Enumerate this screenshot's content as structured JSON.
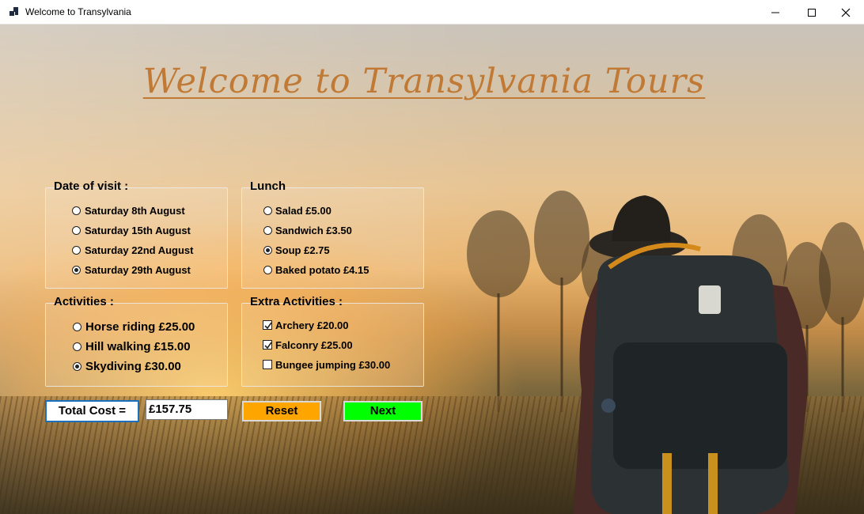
{
  "window": {
    "title": "Welcome to Transylvania"
  },
  "heading": "Welcome to Transylvania Tours",
  "date_group": {
    "legend": "Date of visit :",
    "options": [
      {
        "label": "Saturday 8th August",
        "selected": false
      },
      {
        "label": "Saturday 15th August",
        "selected": false
      },
      {
        "label": "Saturday 22nd August",
        "selected": false
      },
      {
        "label": "Saturday 29th August",
        "selected": true
      }
    ]
  },
  "lunch_group": {
    "legend": "Lunch",
    "options": [
      {
        "label": "Salad £5.00",
        "selected": false
      },
      {
        "label": "Sandwich £3.50",
        "selected": false
      },
      {
        "label": "Soup £2.75",
        "selected": true
      },
      {
        "label": "Baked potato £4.15",
        "selected": false
      }
    ]
  },
  "activities_group": {
    "legend": "Activities :",
    "options": [
      {
        "label": "Horse riding £25.00",
        "selected": false
      },
      {
        "label": "Hill walking £15.00",
        "selected": false
      },
      {
        "label": "Skydiving £30.00",
        "selected": true
      }
    ]
  },
  "extra_group": {
    "legend": "Extra Activities :",
    "options": [
      {
        "label": "Archery £20.00",
        "checked": true
      },
      {
        "label": "Falconry £25.00",
        "checked": true
      },
      {
        "label": "Bungee jumping £30.00",
        "checked": false
      }
    ]
  },
  "total": {
    "label": "Total Cost =",
    "value": "£157.75"
  },
  "buttons": {
    "reset": "Reset",
    "next": "Next"
  },
  "colors": {
    "heading": "#c07a35",
    "reset_bg": "#ffa500",
    "next_bg": "#00ff00",
    "total_border": "#1a6fbf"
  }
}
